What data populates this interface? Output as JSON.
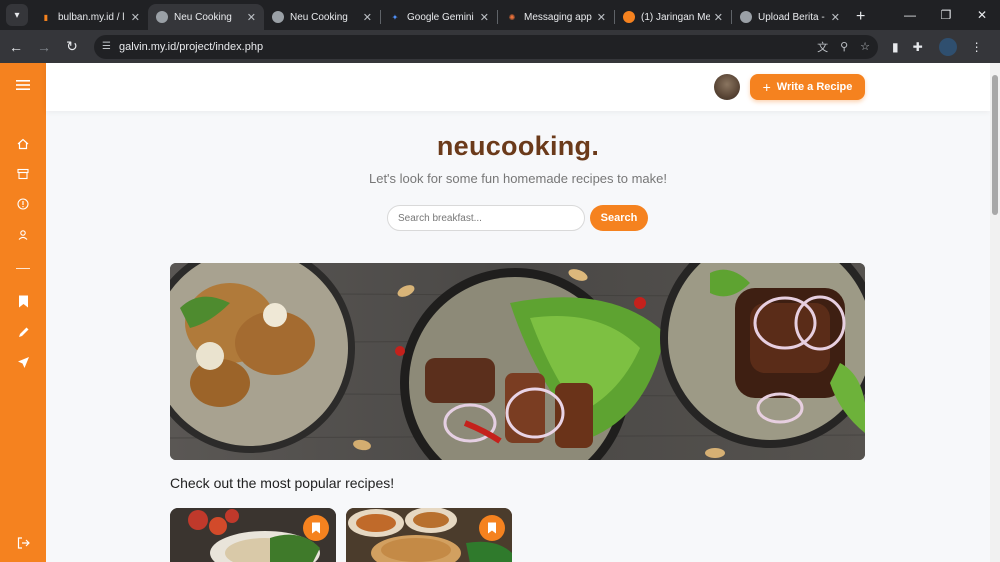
{
  "browser": {
    "tabs": [
      {
        "title": "bulban.my.id / l",
        "active": false,
        "favicon": "orange-bars-icon"
      },
      {
        "title": "Neu Cooking",
        "active": true,
        "favicon": "globe-icon"
      },
      {
        "title": "Neu Cooking",
        "active": false,
        "favicon": "globe-icon"
      },
      {
        "title": "Google Gemini",
        "active": false,
        "favicon": "gemini-icon"
      },
      {
        "title": "Messaging app",
        "active": false,
        "favicon": "asterisk-icon"
      },
      {
        "title": "(1) Jaringan Me",
        "active": false,
        "favicon": "chat-icon"
      },
      {
        "title": "Upload Berita -",
        "active": false,
        "favicon": "globe-icon"
      }
    ],
    "url": "galvin.my.id/project/index.php"
  },
  "nav": {
    "write_button_label": "Write a Recipe"
  },
  "hero": {
    "brand": "neucooking.",
    "tagline": "Let's look for some fun homemade recipes to make!"
  },
  "search": {
    "placeholder": "Search breakfast...",
    "button_label": "Search"
  },
  "popular": {
    "title": "Check out the most popular recipes!"
  },
  "colors": {
    "accent": "#f5821f",
    "brand_text": "#6b3a1a"
  }
}
